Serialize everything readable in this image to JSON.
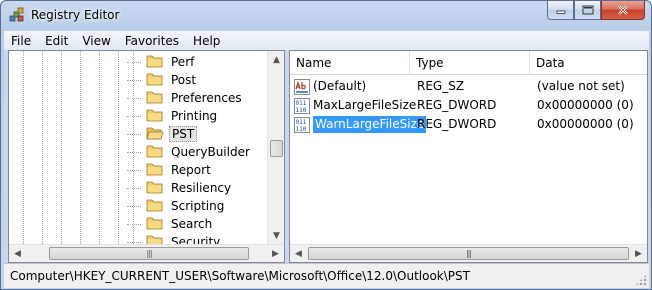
{
  "window": {
    "title": "Registry Editor",
    "caption_icons": [
      "minimize-icon",
      "maximize-icon",
      "close-icon"
    ]
  },
  "menu": [
    "File",
    "Edit",
    "View",
    "Favorites",
    "Help"
  ],
  "tree": {
    "items": [
      {
        "label": "Perf",
        "expandable": true,
        "selected": false
      },
      {
        "label": "Post",
        "expandable": false,
        "selected": false
      },
      {
        "label": "Preferences",
        "expandable": true,
        "selected": false
      },
      {
        "label": "Printing",
        "expandable": true,
        "selected": false
      },
      {
        "label": "PST",
        "expandable": false,
        "selected": true
      },
      {
        "label": "QueryBuilder",
        "expandable": false,
        "selected": false
      },
      {
        "label": "Report",
        "expandable": false,
        "selected": false
      },
      {
        "label": "Resiliency",
        "expandable": true,
        "selected": false
      },
      {
        "label": "Scripting",
        "expandable": false,
        "selected": false
      },
      {
        "label": "Search",
        "expandable": true,
        "selected": false
      },
      {
        "label": "Security",
        "expandable": false,
        "selected": false
      }
    ]
  },
  "list": {
    "columns": [
      "Name",
      "Type",
      "Data"
    ],
    "rows": [
      {
        "icon": "string-value-icon",
        "name": "(Default)",
        "type": "REG_SZ",
        "data": "(value not set)",
        "selected": false
      },
      {
        "icon": "dword-value-icon",
        "name": "MaxLargeFileSize",
        "type": "REG_DWORD",
        "data": "0x00000000 (0)",
        "selected": false
      },
      {
        "icon": "dword-value-icon",
        "name": "WarnLargeFileSize",
        "type": "REG_DWORD",
        "data": "0x00000000 (0)",
        "selected": true
      }
    ]
  },
  "status": {
    "path": "Computer\\HKEY_CURRENT_USER\\Software\\Microsoft\\Office\\12.0\\Outlook\\PST"
  },
  "colors": {
    "selection": "#3399ff",
    "title_bar": "#c9daf0",
    "close_button": "#c8432b"
  }
}
